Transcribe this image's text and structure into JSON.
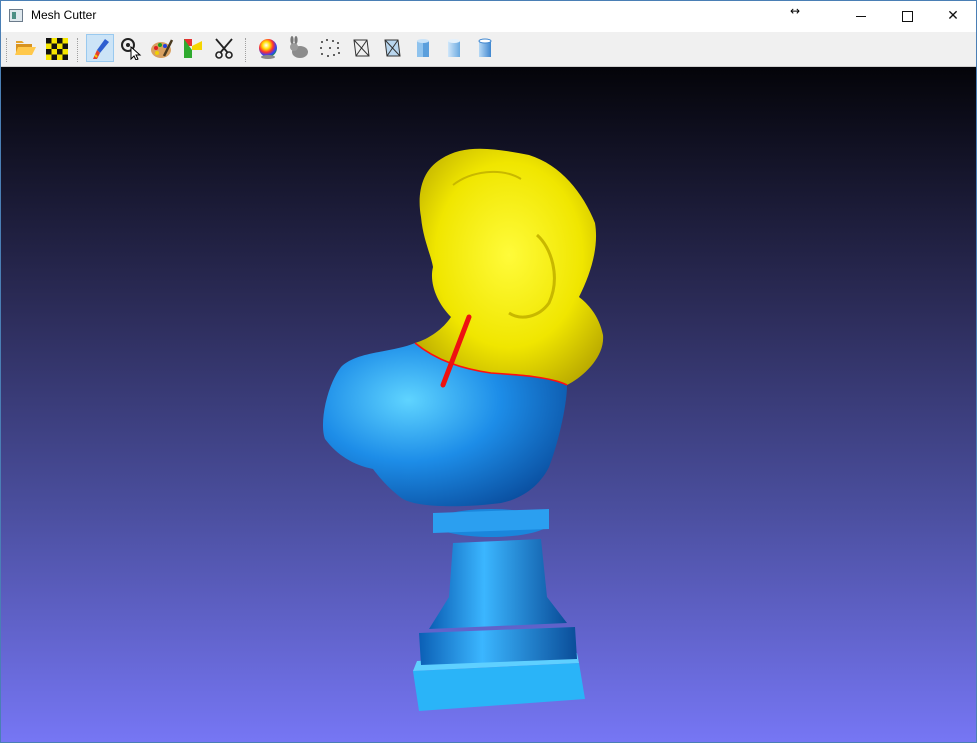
{
  "window": {
    "title": "Mesh Cutter",
    "controls": [
      "minimize",
      "maximize",
      "close"
    ]
  },
  "toolbar": {
    "groups": [
      {
        "items": [
          {
            "name": "open-folder",
            "icon": "folder-icon"
          },
          {
            "name": "checkerboard",
            "icon": "checkerboard-icon"
          }
        ]
      },
      {
        "items": [
          {
            "name": "paint-brush",
            "icon": "brush-icon",
            "active": true
          },
          {
            "name": "select",
            "icon": "select-cursor-icon"
          },
          {
            "name": "color-palette",
            "icon": "palette-icon"
          },
          {
            "name": "flip",
            "icon": "flip-icon"
          },
          {
            "name": "cut",
            "icon": "scissors-icon"
          }
        ]
      },
      {
        "items": [
          {
            "name": "color-sphere",
            "icon": "color-sphere-icon"
          },
          {
            "name": "bunny",
            "icon": "bunny-icon"
          },
          {
            "name": "points",
            "icon": "points-icon"
          },
          {
            "name": "wireframe",
            "icon": "wireframe-icon"
          },
          {
            "name": "wireframe-shaded",
            "icon": "wireframe-shaded-icon"
          },
          {
            "name": "flat-shading",
            "icon": "flat-cylinder-icon"
          },
          {
            "name": "smooth-shading",
            "icon": "smooth-cylinder-icon"
          },
          {
            "name": "textured-shading",
            "icon": "textured-cylinder-icon"
          }
        ]
      }
    ]
  },
  "viewport": {
    "background_top": "#040409",
    "background_bottom": "#7676f4",
    "model": "bust",
    "segment_colors": {
      "upper": "#f4f000",
      "lower": "#1a8cf0"
    },
    "cut_boundary_color": "#ff1010",
    "stroke_color": "#ee1111"
  }
}
